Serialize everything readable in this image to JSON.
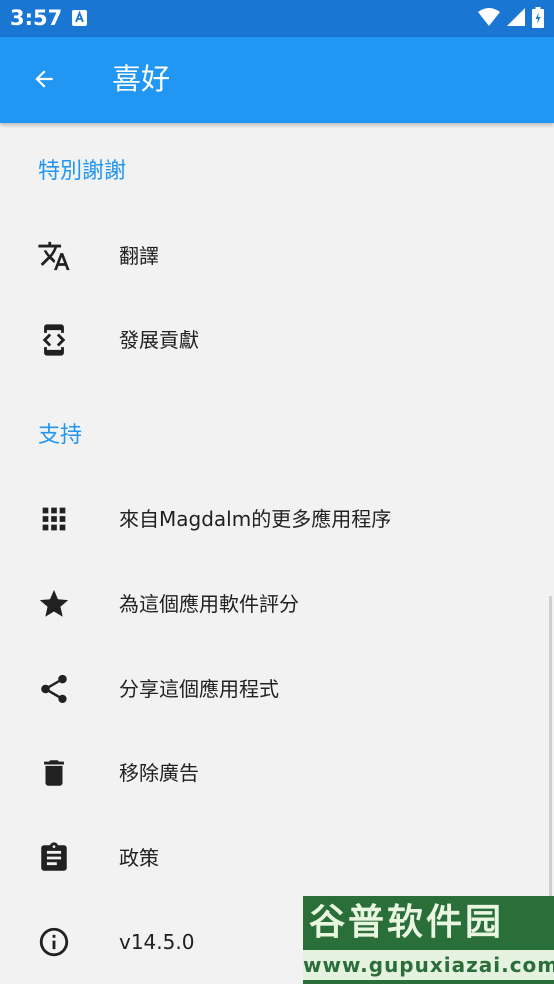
{
  "status_bar": {
    "time": "3:57"
  },
  "app_bar": {
    "title": "喜好"
  },
  "sections": {
    "thanks": {
      "header": "特別謝謝",
      "items": [
        {
          "label": "翻譯"
        },
        {
          "label": "發展貢獻"
        }
      ]
    },
    "support": {
      "header": "支持",
      "items": [
        {
          "label": "來自Magdalm的更多應用程序"
        },
        {
          "label": "為這個應用軟件評分"
        },
        {
          "label": "分享這個應用程式"
        },
        {
          "label": "移除廣告"
        },
        {
          "label": "政策"
        },
        {
          "label": "v14.5.0"
        }
      ]
    }
  },
  "watermark": {
    "title": "谷普软件园",
    "url": "www.gupuxiazai.com"
  },
  "colors": {
    "status_bar": "#1976d2",
    "app_bar": "#2196f3",
    "accent": "#2196f3",
    "background": "#f2f2f2"
  },
  "icons": [
    "translate-icon",
    "developer-mode-icon",
    "apps-grid-icon",
    "star-icon",
    "share-icon",
    "delete-icon",
    "clipboard-icon",
    "info-icon"
  ]
}
